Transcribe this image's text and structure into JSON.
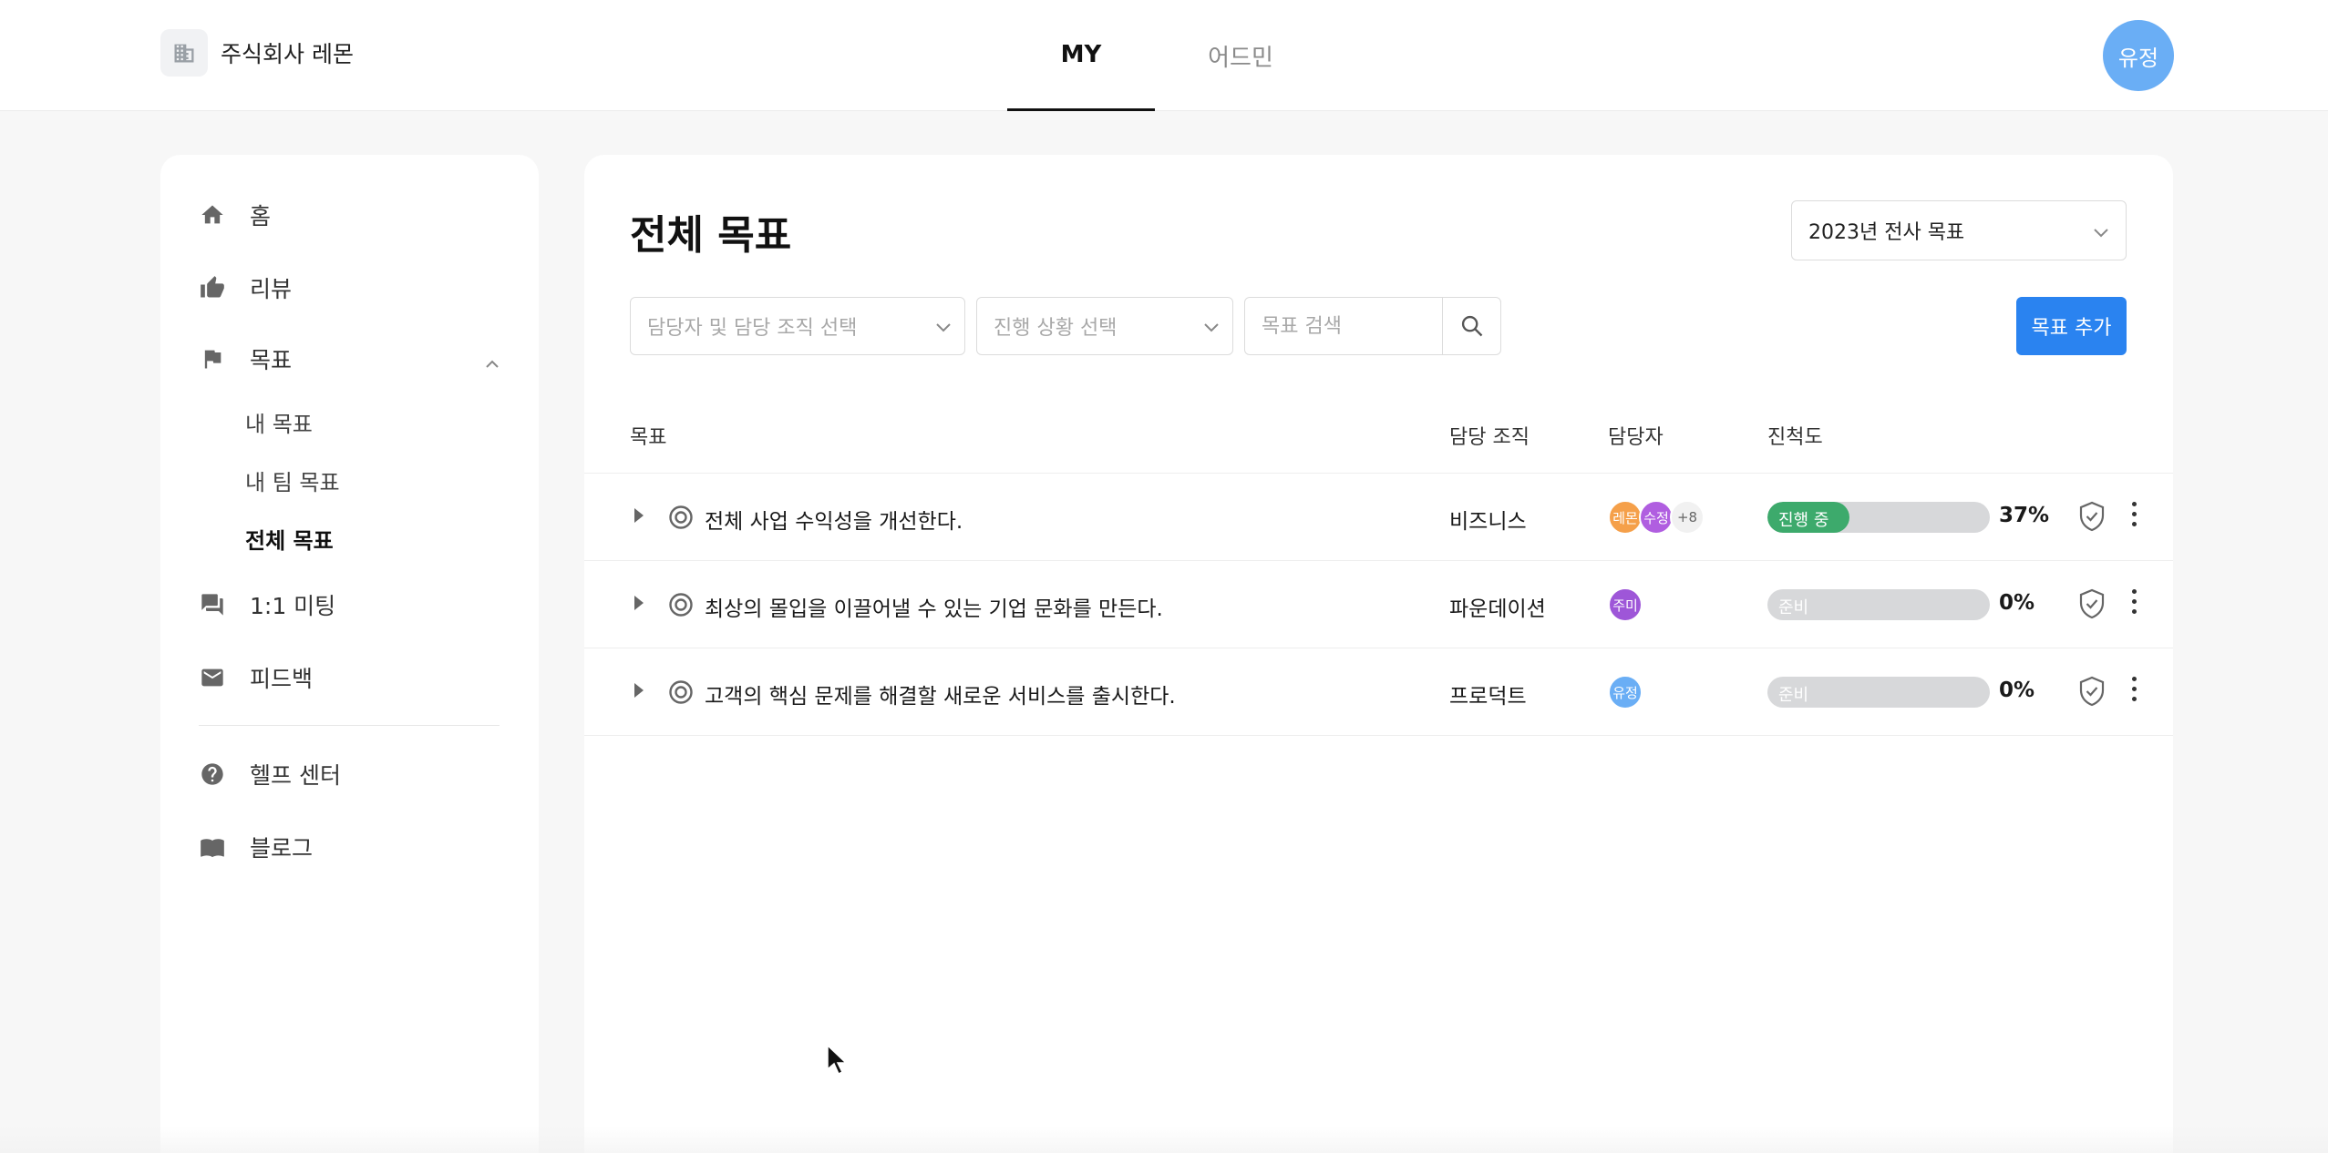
{
  "header": {
    "company_name": "주식회사 레몬",
    "tabs": [
      {
        "label": "MY",
        "active": true
      },
      {
        "label": "어드민",
        "active": false
      }
    ],
    "user_avatar": "유정",
    "user_avatar_color": "#6aaef5"
  },
  "sidebar": {
    "items": [
      {
        "label": "홈",
        "icon": "home-icon"
      },
      {
        "label": "리뷰",
        "icon": "thumbs-up-icon"
      },
      {
        "label": "목표",
        "icon": "flag-icon",
        "expanded": true,
        "children": [
          {
            "label": "내 목표"
          },
          {
            "label": "내 팀 목표"
          },
          {
            "label": "전체 목표",
            "active": true
          }
        ]
      },
      {
        "label": "1:1 미팅",
        "icon": "chat-icon"
      },
      {
        "label": "피드백",
        "icon": "mail-icon"
      }
    ],
    "footer_items": [
      {
        "label": "헬프 센터",
        "icon": "help-icon"
      },
      {
        "label": "블로그",
        "icon": "book-icon"
      }
    ]
  },
  "main": {
    "title": "전체 목표",
    "year_select": "2023년 전사 목표",
    "filters": {
      "owner_placeholder": "담당자 및 담당 조직 선택",
      "status_placeholder": "진행 상황 선택",
      "search_placeholder": "목표 검색"
    },
    "add_button": "목표 추가",
    "columns": {
      "goal": "목표",
      "org": "담당 조직",
      "owner": "담당자",
      "progress": "진척도"
    },
    "rows": [
      {
        "title": "전체 사업 수익성을 개선한다.",
        "org": "비즈니스",
        "owners": [
          {
            "label": "레몬",
            "color": "#f5a04a"
          },
          {
            "label": "수정",
            "color": "#b05ee0"
          }
        ],
        "owners_more": "+8",
        "status": "진행 중",
        "status_color": "#3daa6c",
        "progress": 0.37,
        "progress_text": "37%"
      },
      {
        "title": "최상의 몰입을 이끌어낼 수 있는 기업 문화를 만든다.",
        "org": "파운데이션",
        "owners": [
          {
            "label": "주미",
            "color": "#9e56d8"
          }
        ],
        "owners_more": "",
        "status": "준비",
        "status_color": "#d7d8da",
        "progress": 0,
        "progress_text": "0%"
      },
      {
        "title": "고객의 핵심 문제를 해결할 새로운 서비스를 출시한다.",
        "org": "프로덕트",
        "owners": [
          {
            "label": "유정",
            "color": "#6aaef5"
          }
        ],
        "owners_more": "",
        "status": "준비",
        "status_color": "#d7d8da",
        "progress": 0,
        "progress_text": "0%"
      }
    ]
  }
}
